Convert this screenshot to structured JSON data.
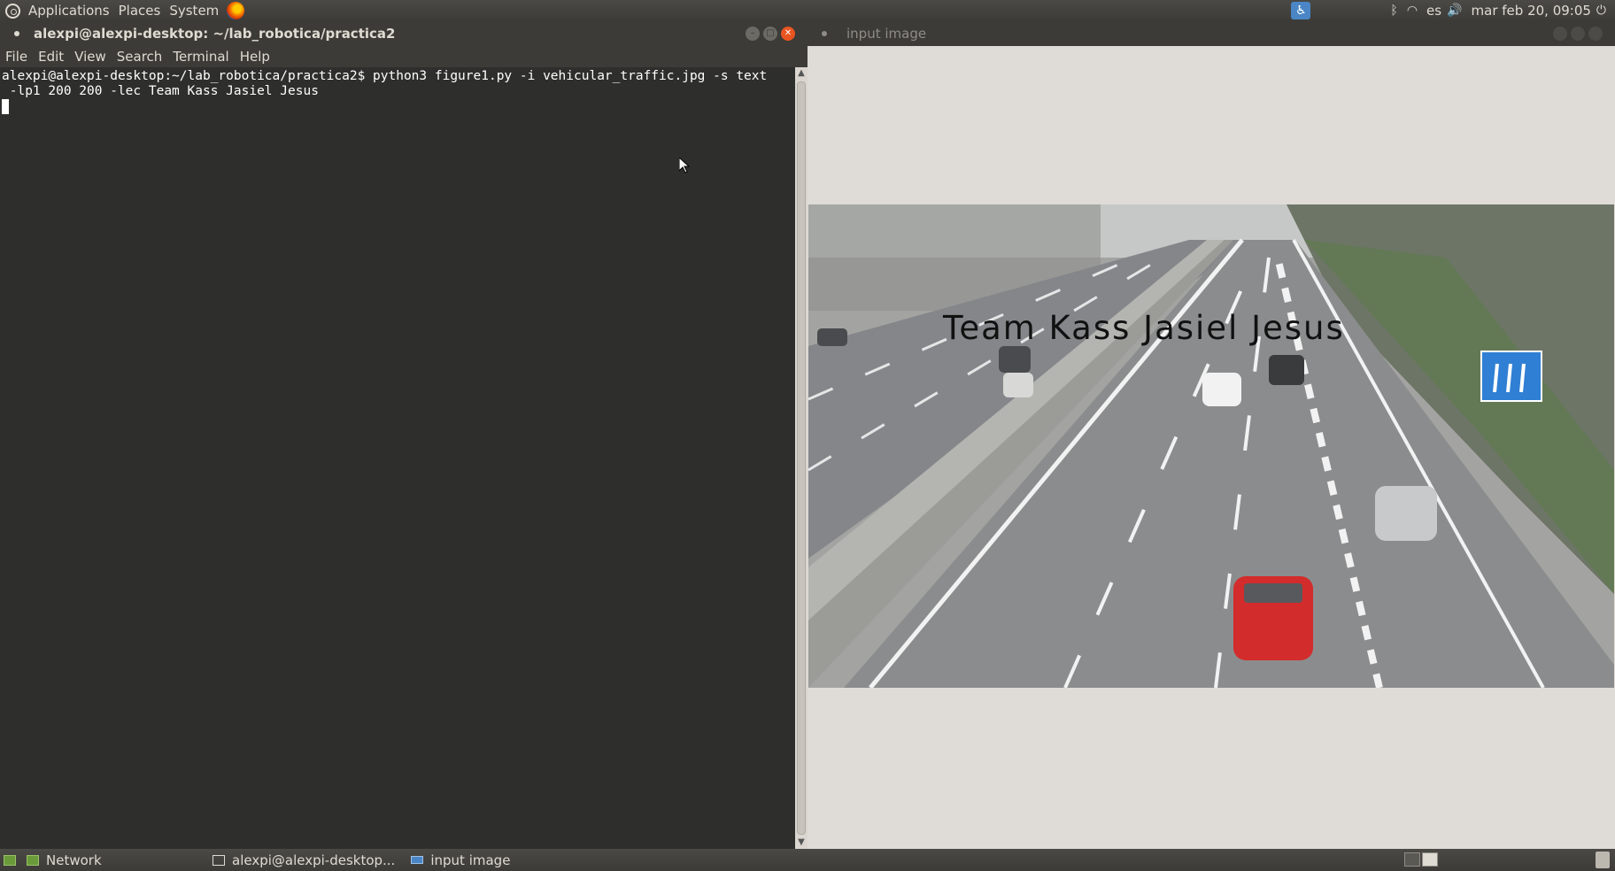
{
  "top_panel": {
    "menus": [
      "Applications",
      "Places",
      "System"
    ],
    "tray": {
      "keyboard_layout": "es",
      "clock": "mar feb 20, 09:05"
    }
  },
  "terminal": {
    "title": "alexpi@alexpi-desktop: ~/lab_robotica/practica2",
    "menu": [
      "File",
      "Edit",
      "View",
      "Search",
      "Terminal",
      "Help"
    ],
    "line1": "alexpi@alexpi-desktop:~/lab_robotica/practica2$ python3 figure1.py -i vehicular_traffic.jpg -s text",
    "line2": " -lp1 200 200 -lec Team Kass Jasiel Jesus"
  },
  "image_window": {
    "title": "input image",
    "overlay_text": "Team Kass Jasiel Jesus"
  },
  "bottom_panel": {
    "tasks": [
      {
        "label": "Network",
        "icon": "network-icon"
      },
      {
        "label": "alexpi@alexpi-desktop...",
        "icon": "terminal-icon"
      },
      {
        "label": "input image",
        "icon": "image-window-icon"
      }
    ]
  },
  "colors": {
    "panel": "#3c3b37",
    "terminal_bg": "#2e2e2c",
    "accent_close": "#e95420",
    "image_window_bg": "#dfdbd6"
  }
}
